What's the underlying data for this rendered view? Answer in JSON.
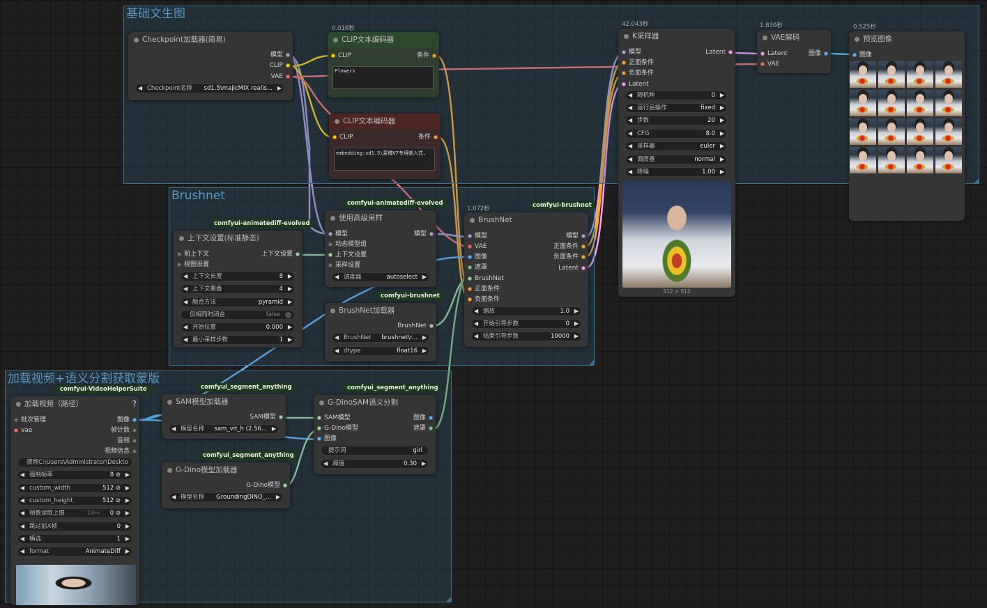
{
  "groups": {
    "basic": "基础文生图",
    "brushnet": "Brushnet",
    "video": "加载视频+语义分割获取蒙版"
  },
  "checkpoint": {
    "title": "Checkpoint加载器(简易)",
    "out_model": "模型",
    "out_clip": "CLIP",
    "out_vae": "VAE",
    "w_name_label": "Checkpoint名称",
    "w_name_value": "sd1.5\\majicMIX realis..."
  },
  "clip_pos": {
    "timing": "0.016秒",
    "title": "CLIP文本编码器",
    "in_clip": "CLIP",
    "out_cond": "条件",
    "text": "Flowers"
  },
  "clip_neg": {
    "title": "CLIP文本编码器",
    "in_clip": "CLIP",
    "out_cond": "条件",
    "text": "embedding:sd1.5\\麦橘V7专用嵌入式,"
  },
  "ksampler": {
    "timing": "42.043秒",
    "title": "K采样器",
    "in_model": "模型",
    "in_pos": "正面条件",
    "in_neg": "负面条件",
    "in_latent": "Latent",
    "out_latent": "Latent",
    "widgets": [
      {
        "label": "随机种",
        "value": "0"
      },
      {
        "label": "运行后操作",
        "value": "fixed"
      },
      {
        "label": "步数",
        "value": "20"
      },
      {
        "label": "CFG",
        "value": "8.0"
      },
      {
        "label": "采样器",
        "value": "euler"
      },
      {
        "label": "调度器",
        "value": "normal"
      },
      {
        "label": "降噪",
        "value": "1.00"
      }
    ],
    "image_caption": "512 × 512"
  },
  "vae_decode": {
    "timing": "1.830秒",
    "title": "VAE解码",
    "in_latent": "Latent",
    "in_vae": "VAE",
    "out_image": "图像"
  },
  "preview": {
    "timing": "0.525秒",
    "title": "预览图像",
    "in_image": "图像"
  },
  "context": {
    "tag": "comfyui-animatediff-evolved",
    "title": "上下文设置(标准静态)",
    "in_prev": "前上下文",
    "in_view": "视图设置",
    "out_ctx": "上下文设置",
    "widgets": [
      {
        "label": "上下文长度",
        "value": "8"
      },
      {
        "label": "上下文重叠",
        "value": "4"
      },
      {
        "label": "融合方法",
        "value": "pyramid"
      },
      {
        "label": "仅相同时闭合",
        "value": "false"
      },
      {
        "label": "开始位置",
        "value": "0.000"
      },
      {
        "label": "最小采样步数",
        "value": "1"
      }
    ]
  },
  "adv_sample": {
    "tag": "comfyui-animatediff-evolved",
    "title": "使用高级采样",
    "in_model": "模型",
    "in_motion": "动态模型组",
    "in_ctx": "上下文设置",
    "in_sample": "采样设置",
    "out_model": "模型",
    "w_label": "调度器",
    "w_value": "autoselect"
  },
  "brushnet": {
    "timing": "1.072秒",
    "tag": "comfyui-brushnet",
    "title": "BrushNet",
    "inputs": [
      "模型",
      "VAE",
      "图像",
      "遮罩",
      "BrushNet",
      "正面条件",
      "负面条件"
    ],
    "outputs": [
      "模型",
      "正面条件",
      "负面条件",
      "Latent"
    ],
    "widgets": [
      {
        "label": "缩放",
        "value": "1.0"
      },
      {
        "label": "开始引导步数",
        "value": "0"
      },
      {
        "label": "结束引导步数",
        "value": "10000"
      }
    ]
  },
  "brushnet_loader": {
    "tag": "comfyui-brushnet",
    "title": "BrushNet加载器",
    "out": "BrushNet",
    "widgets": [
      {
        "label": "BrushNet",
        "value": "brushnet\\r..."
      },
      {
        "label": "dtype",
        "value": "float16"
      }
    ]
  },
  "load_video": {
    "tag": "comfyui-VideoHelperSuite",
    "title": "加载视频（路径）",
    "help": "?",
    "in_batch": "批次管理",
    "in_vae": "vae",
    "outputs": [
      "图像",
      "帧计数",
      "音频",
      "视频信息"
    ],
    "path": "视频C:\\Users\\Administrator\\Deskto",
    "widgets": [
      {
        "label": "强制帧率",
        "value": "8 ⊘"
      },
      {
        "label": "custom_width",
        "value": "512 ⊘"
      },
      {
        "label": "custom_height",
        "value": "512 ⊘"
      },
      {
        "label": "帧数读取上限",
        "value": "0 ⊘",
        "extra": "16↔"
      },
      {
        "label": "跳过前X帧",
        "value": "0"
      },
      {
        "label": "横选",
        "value": "1"
      },
      {
        "label": "format",
        "value": "AnimateDiff"
      }
    ]
  },
  "sam_loader": {
    "tag": "comfyui_segment_anything",
    "title": "SAM模型加载器",
    "out": "SAM模型",
    "w_label": "模型名称",
    "w_value": "sam_vit_h (2.56..."
  },
  "gdino_loader": {
    "tag": "comfyui_segment_anything",
    "title": "G-Dino模型加载器",
    "out": "G-Dino模型",
    "w_label": "模型名称",
    "w_value": "GroundingDINO_..."
  },
  "gdinosam": {
    "tag": "comfyui_segment_anything",
    "title": "G-DinoSAM语义分割",
    "in_sam": "SAM模型",
    "in_gdino": "G-Dino模型",
    "in_image": "图像",
    "out_image": "图像",
    "out_mask": "遮罩",
    "prompt_label": "提示词",
    "prompt_value": "girl",
    "th_label": "阈值",
    "th_value": "0.30"
  },
  "colors": {
    "model": "#b39ddb",
    "clip": "#ffd500",
    "vae": "#ff6e6e",
    "cond": "#ffa931",
    "latent": "#ff9cf9",
    "image": "#64b5f6",
    "mask": "#81c784",
    "other": "#a5d6a7"
  }
}
